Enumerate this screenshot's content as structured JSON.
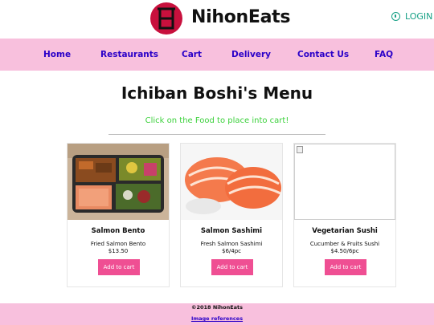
{
  "header": {
    "brand": "NihonEats",
    "login_label": "LOGIN"
  },
  "nav": {
    "items": [
      "Home",
      "Restaurants",
      "Cart",
      "Delivery",
      "Contact Us",
      "FAQ"
    ]
  },
  "main": {
    "title": "Ichiban Boshi's Menu",
    "subtitle": "Click on the Food to place into cart!"
  },
  "products": [
    {
      "name": "Salmon Bento",
      "desc": "Fried Salmon Bento",
      "price": "$13.50",
      "button": "Add to cart",
      "image_icon": "salmon-bento-image"
    },
    {
      "name": "Salmon Sashimi",
      "desc": "Fresh Salmon Sashimi",
      "price": "$6/4pc",
      "button": "Add to cart",
      "image_icon": "salmon-sashimi-image"
    },
    {
      "name": "Vegetarian Sushi",
      "desc": "Cucumber & Fruits Sushi",
      "price": "$4.50/6pc",
      "button": "Add to cart",
      "image_icon": "broken-image-icon"
    }
  ],
  "footer": {
    "copyright": "©2018 NihonEats",
    "references": "Image references"
  },
  "colors": {
    "nav_bg": "#f8c0dd",
    "nav_link": "#2a00c8",
    "button": "#ef4f93",
    "subtitle": "#3bd13b",
    "login": "#16a085",
    "logo": "#c8103d"
  }
}
